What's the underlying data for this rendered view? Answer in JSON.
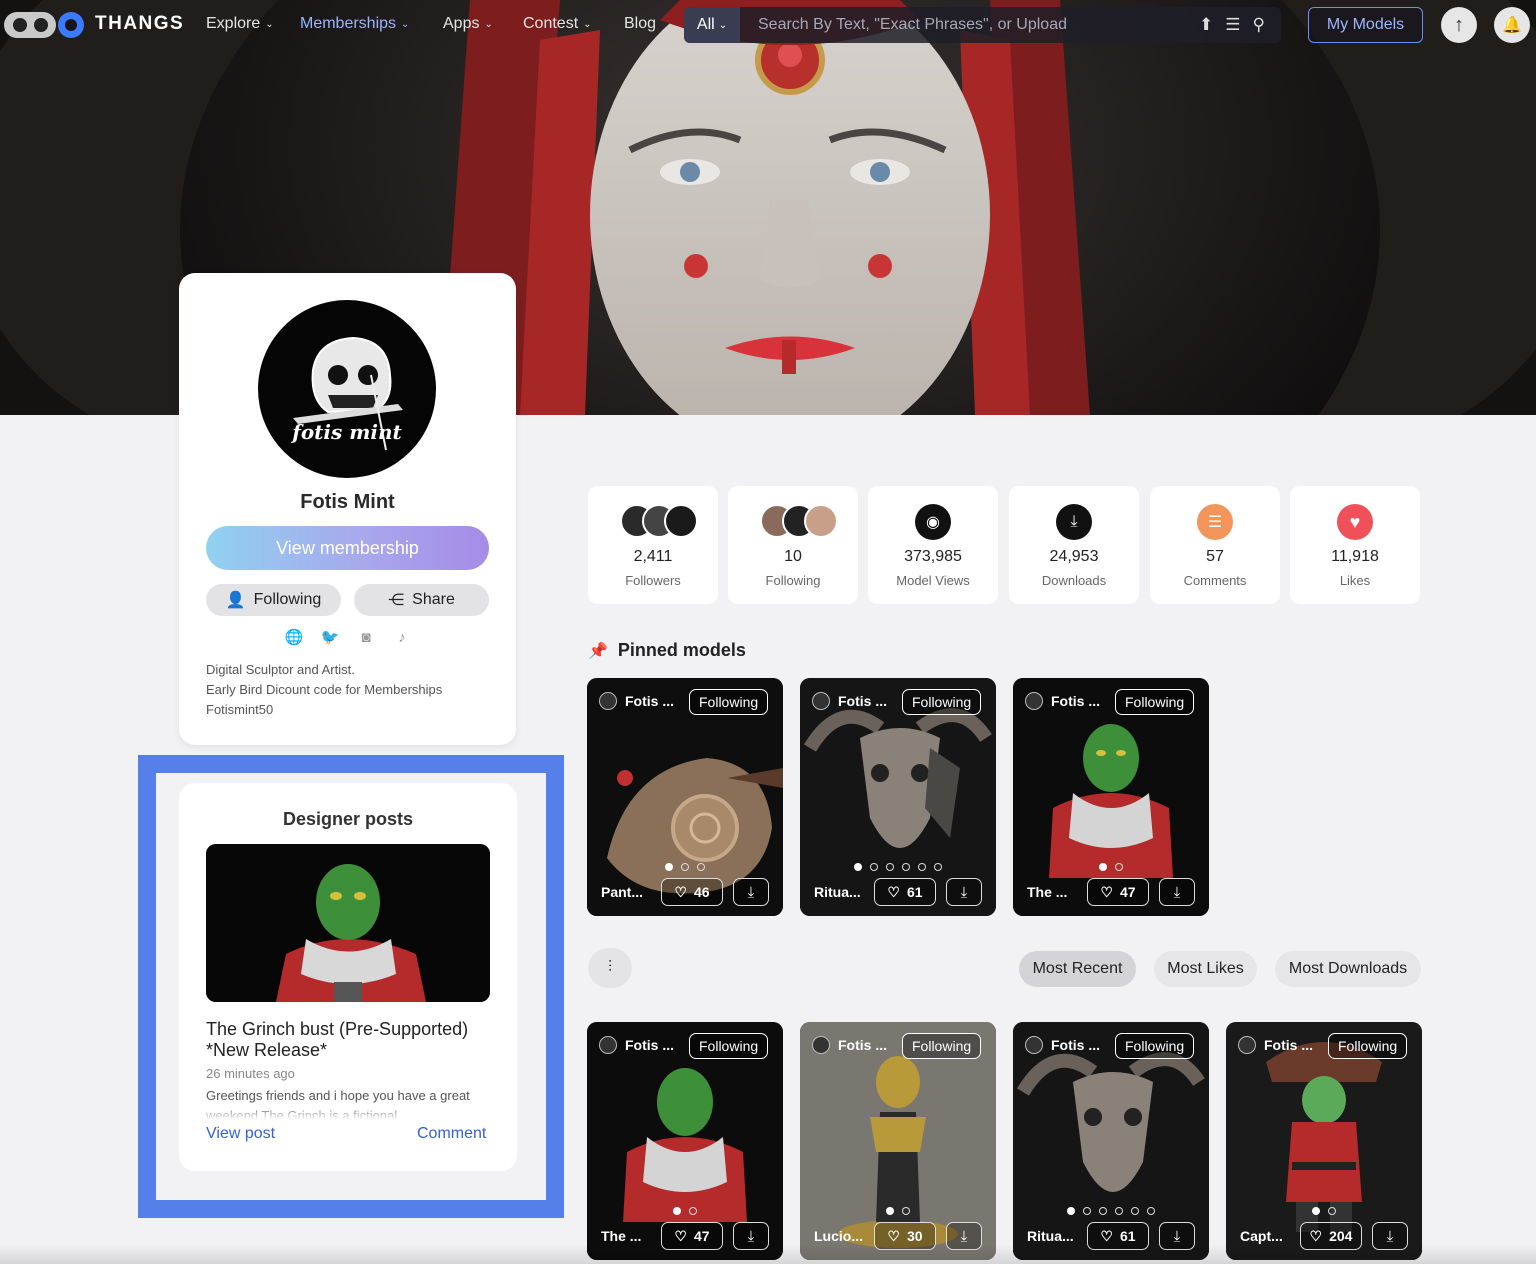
{
  "nav": {
    "brand": "THANGS",
    "items": [
      {
        "label": "Explore",
        "caret": "⌄"
      },
      {
        "label": "Memberships",
        "caret": "⌄"
      },
      {
        "label": "Apps",
        "caret": "⌄"
      },
      {
        "label": "Contest",
        "caret": "⌄"
      },
      {
        "label": "Blog"
      }
    ],
    "search": {
      "scope": "All",
      "placeholder": "Search By Text, \"Exact Phrases\", or Upload"
    },
    "my_models": "My Models",
    "upload_icon": "↑",
    "bell_icon": "🔔"
  },
  "profile": {
    "name": "Fotis Mint",
    "logo_text": "fotis mint",
    "view_membership": "View membership",
    "following": "Following",
    "share": "Share",
    "bio": [
      "Digital Sculptor and Artist.",
      "Early Bird Dicount code for Memberships",
      "Fotismint50"
    ]
  },
  "designer_posts": {
    "heading": "Designer posts",
    "title": "The Grinch bust (Pre-Supported) *New Release*",
    "time": "26 minutes ago",
    "excerpt": "Greetings friends and i hope you have a great weekend The Grinch is a fictional",
    "view_post": "View post",
    "comment": "Comment"
  },
  "stats": [
    {
      "value": "2,411",
      "label": "Followers",
      "icon": "avatar-stack"
    },
    {
      "value": "10",
      "label": "Following",
      "icon": "avatar-stack"
    },
    {
      "value": "373,985",
      "label": "Model Views",
      "icon": "eye-icon",
      "color": "#111111"
    },
    {
      "value": "24,953",
      "label": "Downloads",
      "icon": "download-icon",
      "color": "#111111"
    },
    {
      "value": "57",
      "label": "Comments",
      "icon": "comment-icon",
      "color": "#f2955a"
    },
    {
      "value": "11,918",
      "label": "Likes",
      "icon": "heart-icon",
      "color": "#f0505a"
    }
  ],
  "pinned": {
    "heading": "Pinned models",
    "cards": [
      {
        "owner": "Fotis ...",
        "follow": "Following",
        "title": "Pant...",
        "likes": "46"
      },
      {
        "owner": "Fotis ...",
        "follow": "Following",
        "title": "Ritua...",
        "likes": "61"
      },
      {
        "owner": "Fotis ...",
        "follow": "Following",
        "title": "The ...",
        "likes": "47"
      }
    ]
  },
  "sort": {
    "most_recent": "Most Recent",
    "most_likes": "Most Likes",
    "most_downloads": "Most Downloads"
  },
  "models": [
    {
      "owner": "Fotis ...",
      "follow": "Following",
      "title": "The ...",
      "likes": "47"
    },
    {
      "owner": "Fotis ...",
      "follow": "Following",
      "title": "Lucio...",
      "likes": "30"
    },
    {
      "owner": "Fotis ...",
      "follow": "Following",
      "title": "Ritua...",
      "likes": "61"
    },
    {
      "owner": "Fotis ...",
      "follow": "Following",
      "title": "Capt...",
      "likes": "204"
    }
  ]
}
